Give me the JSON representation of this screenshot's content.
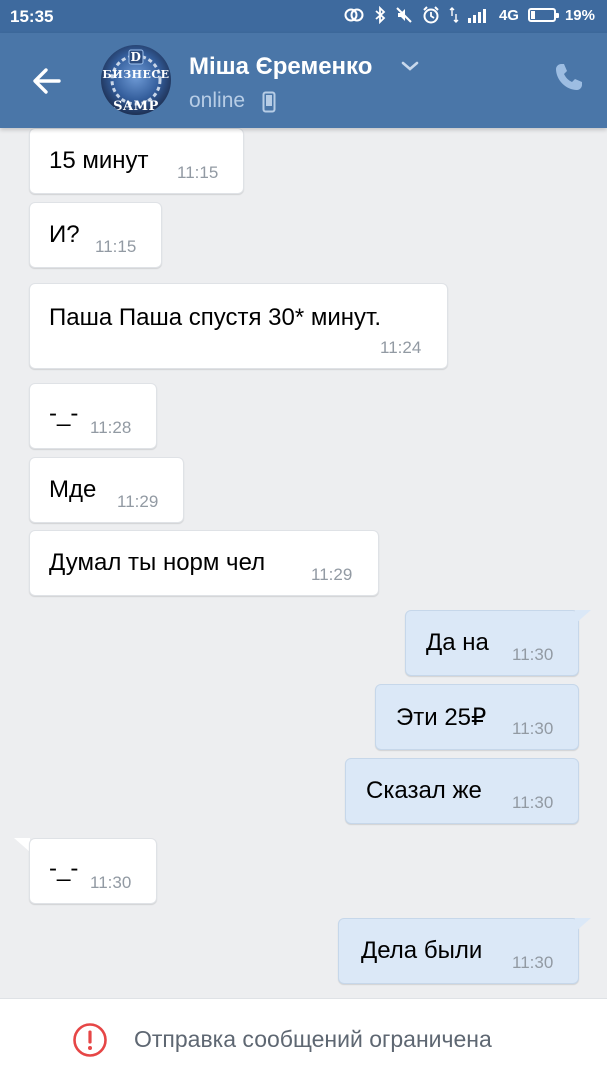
{
  "status_bar": {
    "time": "15:35",
    "network": "4G",
    "battery": "19%",
    "battery_level": 0.19,
    "icons": [
      "link-icon",
      "bluetooth-icon",
      "mute-icon",
      "alarm-icon",
      "data-arrows-icon",
      "signal-icon",
      "battery-icon"
    ]
  },
  "header": {
    "contact_name": "Міша Єременко",
    "status": "online",
    "avatar_text_top": "БИЗНЕСЕ",
    "avatar_text_bottom": "SAMP",
    "avatar_text_badge": "D"
  },
  "messages": [
    {
      "direction": "in",
      "text": "15 минут",
      "time": "11:15"
    },
    {
      "direction": "in",
      "text": "И?",
      "time": "11:15"
    },
    {
      "direction": "in",
      "text": "Паша Паша спустя 30* минут.",
      "time": "11:24"
    },
    {
      "direction": "in",
      "text": "-_-",
      "time": "11:28"
    },
    {
      "direction": "in",
      "text": "Мде",
      "time": "11:29"
    },
    {
      "direction": "in",
      "text": "Думал ты норм чел",
      "time": "11:29"
    },
    {
      "direction": "out",
      "text": "Да на",
      "time": "11:30"
    },
    {
      "direction": "out",
      "text": "Эти 25₽",
      "time": "11:30"
    },
    {
      "direction": "out",
      "text": "Сказал же",
      "time": "11:30"
    },
    {
      "direction": "in",
      "text": "-_-",
      "time": "11:30"
    },
    {
      "direction": "out",
      "text": "Дела были",
      "time": "11:30"
    }
  ],
  "footer": {
    "restriction_text": "Отправка сообщений ограничена"
  },
  "colors": {
    "header_bg": "#4a76a8",
    "status_bar_bg": "#3e6a9e",
    "chat_bg": "#edeef0",
    "incoming_bubble": "#ffffff",
    "outgoing_bubble": "#dbe8f7",
    "alert_red": "#e64646"
  }
}
